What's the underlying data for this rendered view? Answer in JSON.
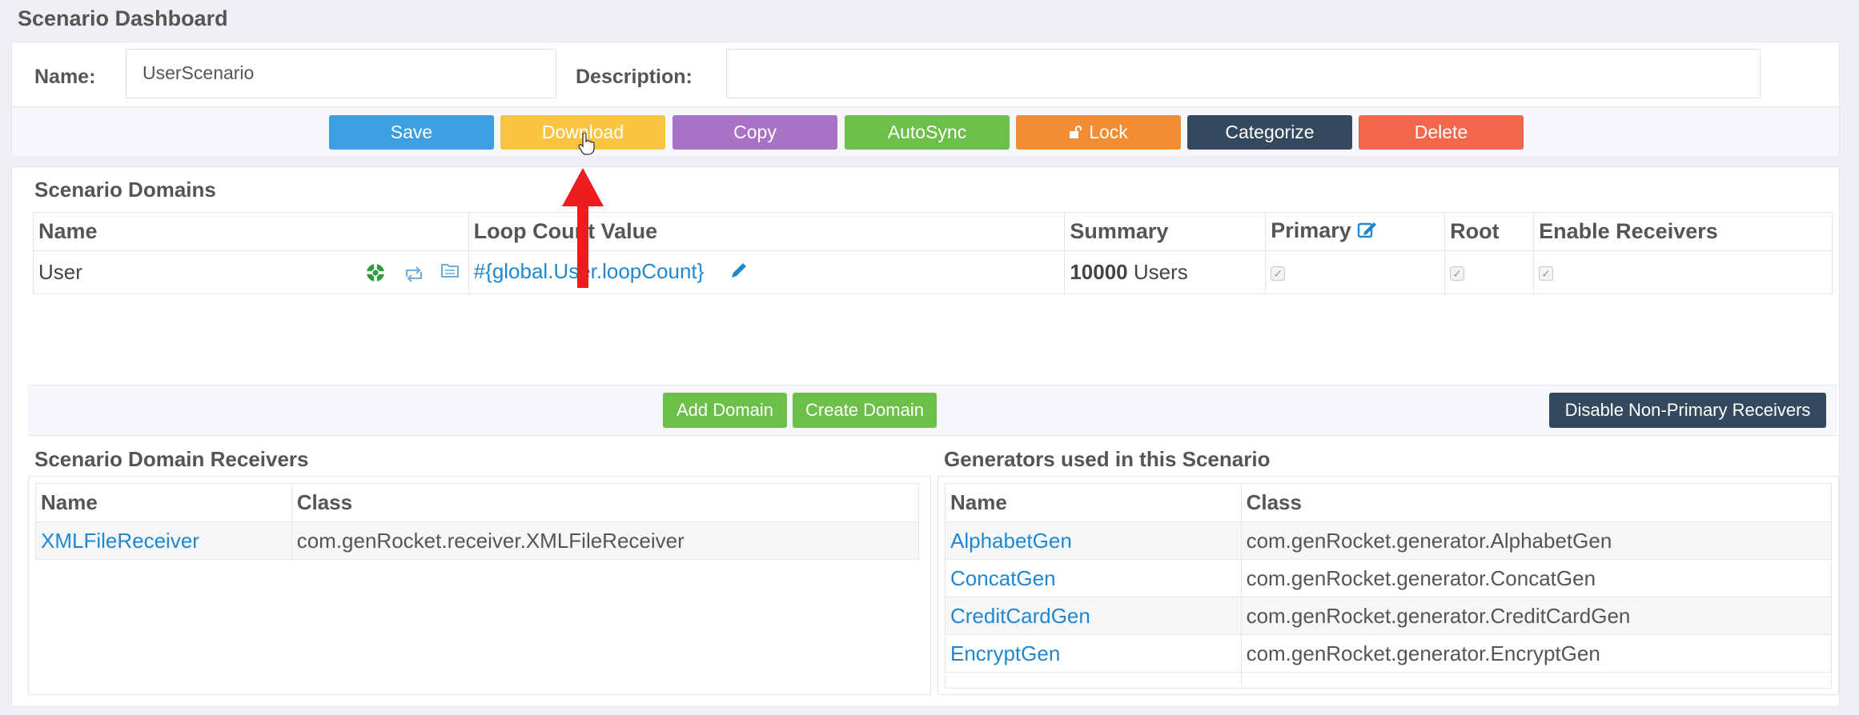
{
  "page": {
    "title": "Scenario Dashboard"
  },
  "form": {
    "name_label": "Name:",
    "name_value": "UserScenario",
    "description_label": "Description:",
    "description_value": ""
  },
  "toolbar": {
    "buttons": [
      {
        "label": "Save",
        "color": "#3d9ee2"
      },
      {
        "label": "Download",
        "color": "#f9c442"
      },
      {
        "label": "Copy",
        "color": "#a972c7"
      },
      {
        "label": "AutoSync",
        "color": "#6cc04a"
      },
      {
        "label": "Lock",
        "color": "#f28d33"
      },
      {
        "label": "Categorize",
        "color": "#34495e"
      },
      {
        "label": "Delete",
        "color": "#f3684c"
      }
    ]
  },
  "domains": {
    "title": "Scenario Domains",
    "columns": [
      "Name",
      "Loop Count Value",
      "Summary",
      "Primary",
      "Root",
      "Enable Receivers"
    ],
    "rows": [
      {
        "name": "User",
        "loop_count": "#{global.User.loopCount}",
        "summary_count": "10000",
        "summary_unit": "Users",
        "primary": true,
        "root": true,
        "enable_receivers": true
      }
    ],
    "add_domain": "Add Domain",
    "create_domain": "Create Domain",
    "disable_receivers": "Disable Non-Primary Receivers"
  },
  "receivers": {
    "title": "Scenario Domain Receivers",
    "columns": [
      "Name",
      "Class"
    ],
    "rows": [
      {
        "name": "XMLFileReceiver",
        "class": "com.genRocket.receiver.XMLFileReceiver"
      }
    ]
  },
  "generators": {
    "title": "Generators used in this Scenario",
    "columns": [
      "Name",
      "Class"
    ],
    "rows": [
      {
        "name": "AlphabetGen",
        "class": "com.genRocket.generator.AlphabetGen"
      },
      {
        "name": "ConcatGen",
        "class": "com.genRocket.generator.ConcatGen"
      },
      {
        "name": "CreditCardGen",
        "class": "com.genRocket.generator.CreditCardGen"
      },
      {
        "name": "EncryptGen",
        "class": "com.genRocket.generator.EncryptGen"
      }
    ]
  },
  "icons": {
    "lock": "unlock-icon",
    "edit": "edit-square-icon",
    "pencil": "pencil-icon",
    "lifebuoy": "lifebuoy-icon",
    "sync": "sync-icon",
    "folder": "folder-icon",
    "checkbox": "checkbox-checked-icon"
  },
  "annotation": {
    "arrow_color": "#ee1c1c"
  }
}
